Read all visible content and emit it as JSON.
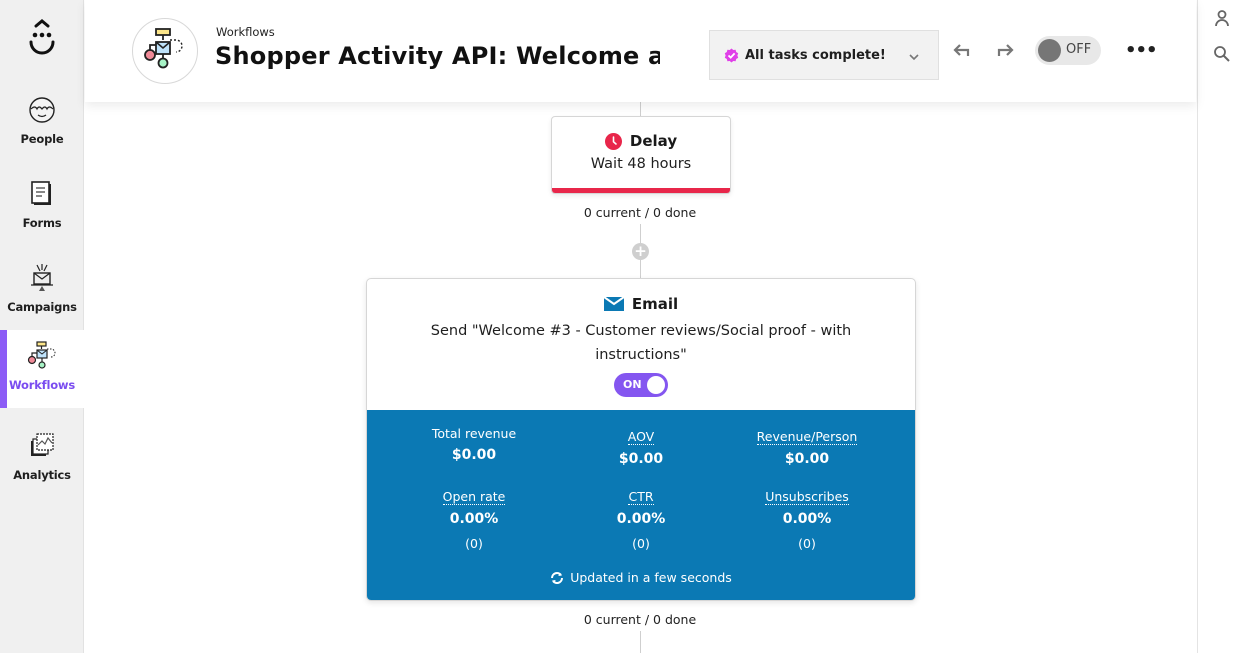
{
  "sidebar": {
    "items": [
      {
        "label": "People",
        "icon": "person-face-icon"
      },
      {
        "label": "Forms",
        "icon": "form-icon"
      },
      {
        "label": "Campaigns",
        "icon": "campaign-envelope-icon"
      },
      {
        "label": "Workflows",
        "icon": "workflow-icon",
        "active": true
      },
      {
        "label": "Analytics",
        "icon": "analytics-icon"
      }
    ]
  },
  "header": {
    "breadcrumb": "Workflows",
    "title": "Shopper Activity API: Welcome and Onboarding",
    "tasks_label": "All tasks complete!",
    "toggle_label": "OFF",
    "more_label": "•••"
  },
  "flow": {
    "delay": {
      "title": "Delay",
      "subtitle": "Wait 48 hours",
      "stats": "0 current / 0 done"
    },
    "email": {
      "title": "Email",
      "description": "Send \"Welcome #3 - Customer reviews/Social proof - with instructions\"",
      "toggle_label": "ON",
      "metrics": [
        {
          "label": "Total revenue",
          "value": "$0.00"
        },
        {
          "label": "AOV",
          "value": "$0.00"
        },
        {
          "label": "Revenue/Person",
          "value": "$0.00"
        },
        {
          "label": "Open rate",
          "value": "0.00%",
          "count": "(0)"
        },
        {
          "label": "CTR",
          "value": "0.00%",
          "count": "(0)"
        },
        {
          "label": "Unsubscribes",
          "value": "0.00%",
          "count": "(0)"
        }
      ],
      "updated": "Updated in a few seconds",
      "stats": "0 current / 0 done"
    }
  },
  "colors": {
    "accent": "#8456f0",
    "delay_bar": "#e8264a",
    "metrics_bg": "#0b79b4",
    "tasks_check": "#e040e8"
  }
}
